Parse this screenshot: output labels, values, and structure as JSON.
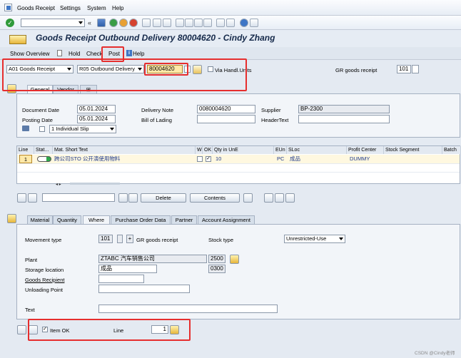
{
  "menu": [
    "Goods Receipt",
    "Settings",
    "System",
    "Help"
  ],
  "title": "Goods Receipt Outbound Delivery 80004620 - Cindy Zhang",
  "appbar": {
    "show_overview": "Show Overview",
    "hold": "Hold",
    "check": "Check",
    "post": "Post",
    "help": "Help"
  },
  "header": {
    "action": "A01 Goods Receipt",
    "reference": "R05 Outbound Delivery",
    "delivery_number": "80004620",
    "via_handling_units": "Via Handl.Units",
    "movement_label": "GR goods receipt",
    "movement_code": "101"
  },
  "doc_tabs": [
    "General",
    "Vendor"
  ],
  "general": {
    "document_date_label": "Document Date",
    "document_date": "05.01.2024",
    "posting_date_label": "Posting Date",
    "posting_date": "05.01.2024",
    "delivery_note_label": "Delivery Note",
    "delivery_note": "0080004620",
    "bill_of_lading_label": "Bill of Lading",
    "bill_of_lading": "",
    "supplier_label": "Supplier",
    "supplier": "BP-2300",
    "header_text_label": "HeaderText",
    "header_text": "",
    "slip": "1 Individual Slip"
  },
  "grid": {
    "columns": [
      "Line",
      "Stat...",
      "Mat. Short Text",
      "W",
      "OK",
      "Qty in UnE",
      "EUn",
      "SLoc",
      "Profit Center",
      "Stock Segment",
      "Batch"
    ],
    "rows": [
      {
        "line": "1",
        "mat_text": "跨公司STO 公开演使用物料",
        "ok": "✓",
        "qty": "10",
        "eun": "PC",
        "sloc": "成品",
        "profit_center": "DUMMY"
      }
    ]
  },
  "grid_toolbar": {
    "delete": "Delete",
    "contents": "Contents"
  },
  "item_tabs": [
    "Material",
    "Quantity",
    "Where",
    "Purchase Order Data",
    "Partner",
    "Account Assignment"
  ],
  "where": {
    "movement_type_label": "Movement type",
    "movement_type": "101",
    "movement_plus": "+",
    "movement_text": "GR goods receipt",
    "stock_type_label": "Stock type",
    "stock_type": "Unrestricted-Use",
    "plant_label": "Plant",
    "plant": "ZTABC 汽车销售公司",
    "plant_code": "2500",
    "storage_location_label": "Storage location",
    "storage_location": "成品",
    "storage_code": "0300",
    "goods_recipient_label": "Goods Recipient",
    "goods_recipient": "",
    "unloading_point_label": "Unloading Point",
    "unloading_point": "",
    "text_label": "Text",
    "text": ""
  },
  "item_footer": {
    "item_ok": "Item OK",
    "line_label": "Line",
    "line": "1"
  },
  "watermark": "CSDN @Cindy老师",
  "colors": {
    "highlight": "#e62e2e",
    "field_active": "#ffe9a8"
  }
}
